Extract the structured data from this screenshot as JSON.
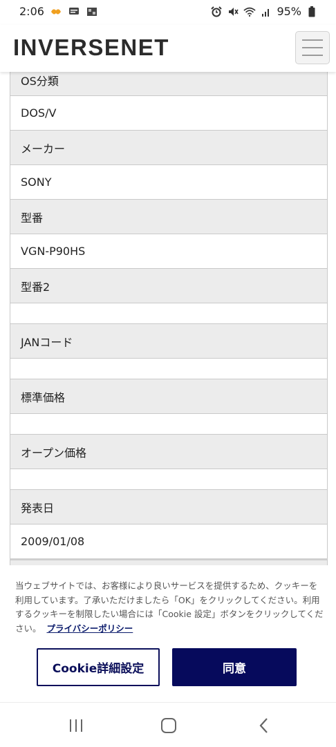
{
  "status_bar": {
    "time": "2:06",
    "battery": "95%"
  },
  "header": {
    "logo": "INVERSENET",
    "menu_icon": "hamburger-menu-icon"
  },
  "spec_rows": [
    {
      "type": "head",
      "label": "OS分類"
    },
    {
      "type": "val",
      "value": "DOS/V"
    },
    {
      "type": "head",
      "label": "メーカー"
    },
    {
      "type": "val",
      "value": "SONY"
    },
    {
      "type": "head",
      "label": "型番"
    },
    {
      "type": "val",
      "value": "VGN-P90HS"
    },
    {
      "type": "head",
      "label": "型番2"
    },
    {
      "type": "val",
      "value": ""
    },
    {
      "type": "head",
      "label": "JANコード"
    },
    {
      "type": "val",
      "value": ""
    },
    {
      "type": "head",
      "label": "標準価格"
    },
    {
      "type": "val",
      "value": ""
    },
    {
      "type": "head",
      "label": "オープン価格"
    },
    {
      "type": "val",
      "value": ""
    },
    {
      "type": "head",
      "label": "発表日"
    },
    {
      "type": "val",
      "value": "2009/01/08"
    }
  ],
  "cookie": {
    "text": "当ウェブサイトでは、お客様により良いサービスを提供するため、クッキーを利用しています。了承いただけましたら「OK」をクリックしてください。利用するクッキーを制限したい場合には「Cookie 設定」ボタンをクリックしてください。",
    "privacy_link": "プライバシーポリシー",
    "settings_button": "Cookie詳細設定",
    "agree_button": "同意"
  },
  "colors": {
    "brand_navy": "#060a5c",
    "row_head_bg": "#ececec",
    "border": "#c9c9c9"
  }
}
